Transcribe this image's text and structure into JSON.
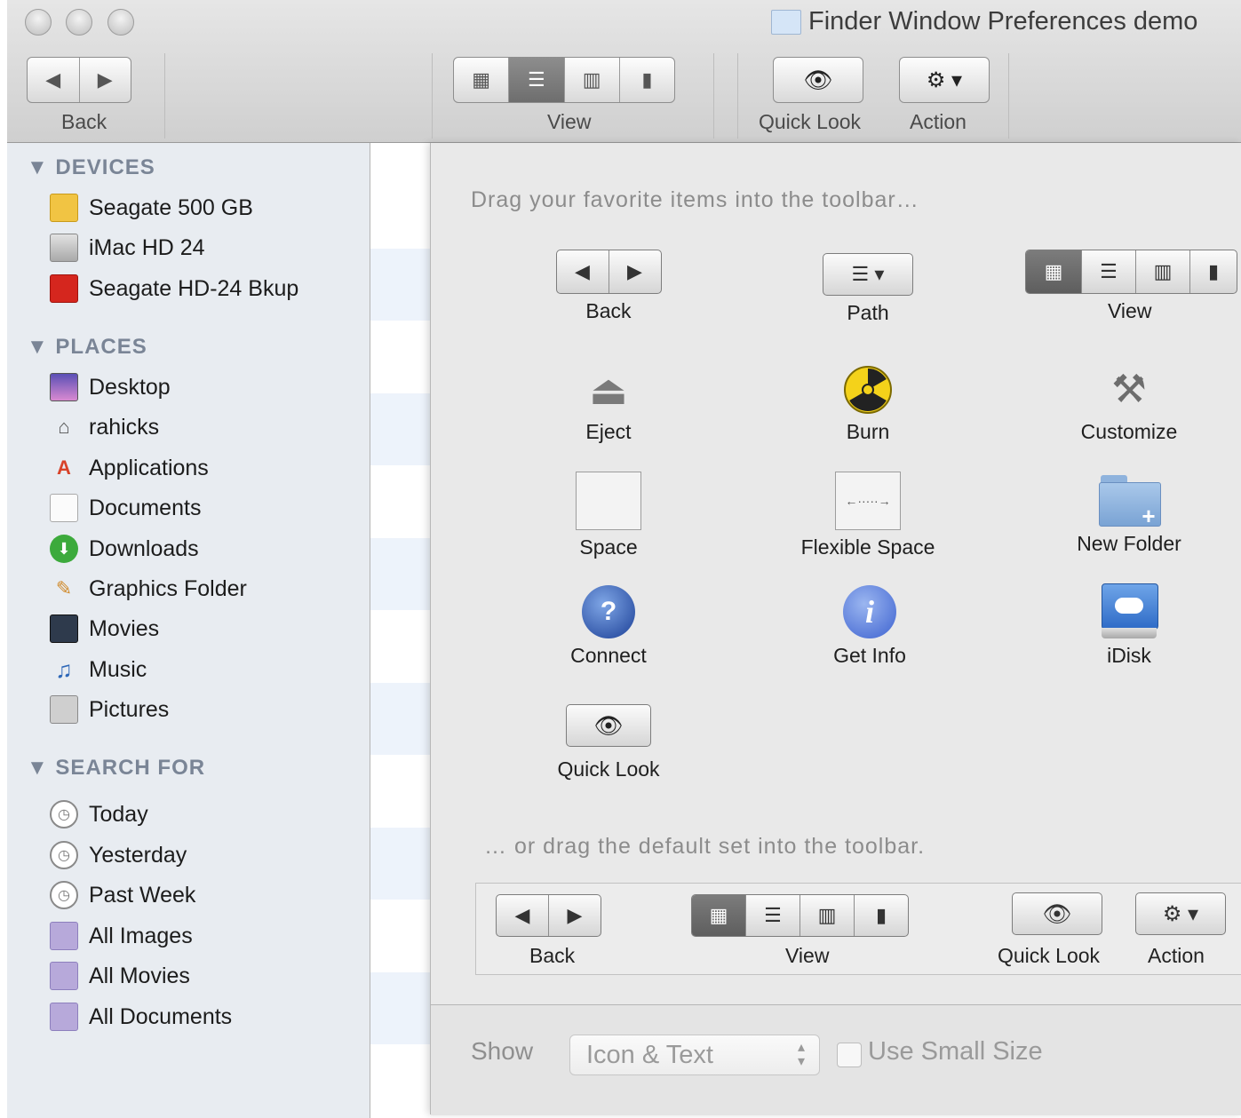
{
  "window": {
    "title": "Finder Window Preferences demo"
  },
  "toolbar": {
    "back_label": "Back",
    "view_label": "View",
    "quicklook_label": "Quick Look",
    "action_label": "Action"
  },
  "sidebar": {
    "devices_heading": "DEVICES",
    "devices": [
      {
        "label": "Seagate 500 GB",
        "icon": "drive-yellow-icon"
      },
      {
        "label": "iMac HD 24",
        "icon": "internal-drive-icon"
      },
      {
        "label": "Seagate HD-24 Bkup",
        "icon": "drive-red-icon"
      }
    ],
    "places_heading": "PLACES",
    "places": [
      {
        "label": "Desktop",
        "icon": "desktop-icon"
      },
      {
        "label": "rahicks",
        "icon": "home-icon"
      },
      {
        "label": "Applications",
        "icon": "applications-icon"
      },
      {
        "label": "Documents",
        "icon": "documents-icon"
      },
      {
        "label": "Downloads",
        "icon": "downloads-icon"
      },
      {
        "label": "Graphics Folder",
        "icon": "graphics-folder-icon"
      },
      {
        "label": "Movies",
        "icon": "movies-icon"
      },
      {
        "label": "Music",
        "icon": "music-icon"
      },
      {
        "label": "Pictures",
        "icon": "pictures-icon"
      }
    ],
    "search_heading": "SEARCH FOR",
    "searches": [
      {
        "label": "Today",
        "icon": "clock-icon"
      },
      {
        "label": "Yesterday",
        "icon": "clock-icon"
      },
      {
        "label": "Past Week",
        "icon": "clock-icon"
      },
      {
        "label": "All Images",
        "icon": "smart-folder-icon"
      },
      {
        "label": "All Movies",
        "icon": "smart-folder-icon"
      },
      {
        "label": "All Documents",
        "icon": "smart-folder-icon"
      }
    ]
  },
  "customize": {
    "drag_hint": "Drag your favorite items into the toolbar…",
    "default_hint": "… or drag the default set into the toolbar.",
    "items": {
      "back": "Back",
      "path": "Path",
      "view": "View",
      "eject": "Eject",
      "burn": "Burn",
      "customize": "Customize",
      "space": "Space",
      "flexible_space": "Flexible Space",
      "new_folder": "New Folder",
      "connect": "Connect",
      "get_info": "Get Info",
      "idisk": "iDisk",
      "quick_look": "Quick Look"
    },
    "default_set": {
      "back": "Back",
      "view": "View",
      "quick_look": "Quick Look",
      "action": "Action"
    },
    "show_label": "Show",
    "show_value": "Icon & Text",
    "small_size_label": "Use Small Size",
    "small_size_checked": false
  },
  "colors": {
    "sidebar_bg": "#e8ecf1",
    "sidebar_heading": "#7a8596",
    "sheet_bg": "#e9e9e9",
    "selected_segment": "#6e6e6e"
  }
}
